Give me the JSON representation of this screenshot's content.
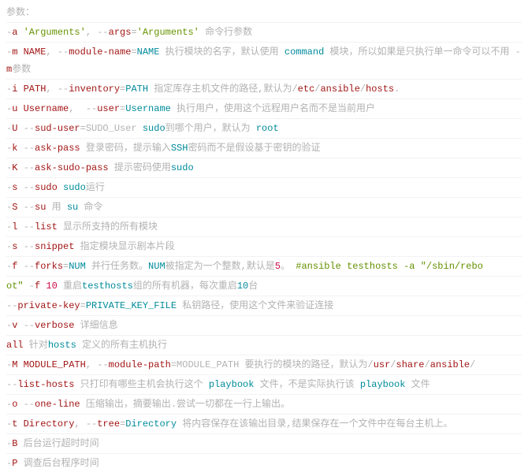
{
  "lines": [
    {
      "segs": [
        {
          "c": "grey",
          "t": "参数："
        }
      ]
    },
    {
      "segs": [
        {
          "c": "grey",
          "t": "-"
        },
        {
          "c": "sel",
          "t": "a "
        },
        {
          "c": "prop",
          "t": "'Arguments'"
        },
        {
          "c": "grey",
          "t": ", --"
        },
        {
          "c": "sel",
          "t": "args"
        },
        {
          "c": "grey",
          "t": "="
        },
        {
          "c": "prop",
          "t": "'Arguments'"
        },
        {
          "c": "grey",
          "t": " 命令行参数"
        }
      ]
    },
    {
      "segs": [
        {
          "c": "grey",
          "t": "-"
        },
        {
          "c": "sel",
          "t": "m NAME"
        },
        {
          "c": "grey",
          "t": ", --"
        },
        {
          "c": "sel",
          "t": "module-name"
        },
        {
          "c": "grey",
          "t": "="
        },
        {
          "c": "val",
          "t": "NAME"
        },
        {
          "c": "grey",
          "t": " 执行模块的名字，默认使用 "
        },
        {
          "c": "val",
          "t": "command"
        },
        {
          "c": "grey",
          "t": " 模块，所以如果是只执行单一命令可以不用 -"
        },
        {
          "c": "sel",
          "t": "m"
        },
        {
          "c": "grey",
          "t": "参数"
        }
      ]
    },
    {
      "segs": [
        {
          "c": "grey",
          "t": "-"
        },
        {
          "c": "sel",
          "t": "i PATH"
        },
        {
          "c": "grey",
          "t": ", --"
        },
        {
          "c": "sel",
          "t": "inventory"
        },
        {
          "c": "grey",
          "t": "="
        },
        {
          "c": "val",
          "t": "PATH"
        },
        {
          "c": "grey",
          "t": " 指定库存主机文件的路径,默认为/"
        },
        {
          "c": "sel",
          "t": "etc"
        },
        {
          "c": "grey",
          "t": "/"
        },
        {
          "c": "sel",
          "t": "ansible"
        },
        {
          "c": "grey",
          "t": "/"
        },
        {
          "c": "sel",
          "t": "hosts"
        },
        {
          "c": "grey",
          "t": "."
        }
      ]
    },
    {
      "segs": [
        {
          "c": "grey",
          "t": "-"
        },
        {
          "c": "sel",
          "t": "u Username"
        },
        {
          "c": "grey",
          "t": ",  --"
        },
        {
          "c": "sel",
          "t": "user"
        },
        {
          "c": "grey",
          "t": "="
        },
        {
          "c": "val",
          "t": "Username"
        },
        {
          "c": "grey",
          "t": " 执行用户，使用这个远程用户名而不是当前用户"
        }
      ]
    },
    {
      "segs": [
        {
          "c": "grey",
          "t": "-"
        },
        {
          "c": "sel",
          "t": "U"
        },
        {
          "c": "grey",
          "t": " --"
        },
        {
          "c": "sel",
          "t": "sud-user"
        },
        {
          "c": "grey",
          "t": "=SUDO_User "
        },
        {
          "c": "val",
          "t": "sudo"
        },
        {
          "c": "grey",
          "t": "到哪个用户，默认为 "
        },
        {
          "c": "val",
          "t": "root"
        }
      ]
    },
    {
      "segs": [
        {
          "c": "grey",
          "t": "-"
        },
        {
          "c": "sel",
          "t": "k"
        },
        {
          "c": "grey",
          "t": " --"
        },
        {
          "c": "sel",
          "t": "ask-pass"
        },
        {
          "c": "grey",
          "t": " 登录密码，提示输入"
        },
        {
          "c": "val",
          "t": "SSH"
        },
        {
          "c": "grey",
          "t": "密码而不是假设基于密钥的验证"
        }
      ]
    },
    {
      "segs": [
        {
          "c": "grey",
          "t": "-"
        },
        {
          "c": "sel",
          "t": "K"
        },
        {
          "c": "grey",
          "t": " --"
        },
        {
          "c": "sel",
          "t": "ask-sudo-pass"
        },
        {
          "c": "grey",
          "t": " 提示密码使用"
        },
        {
          "c": "val",
          "t": "sudo"
        }
      ]
    },
    {
      "segs": [
        {
          "c": "grey",
          "t": "-"
        },
        {
          "c": "sel",
          "t": "s"
        },
        {
          "c": "grey",
          "t": " --"
        },
        {
          "c": "sel",
          "t": "sudo"
        },
        {
          "c": "grey",
          "t": " "
        },
        {
          "c": "val",
          "t": "sudo"
        },
        {
          "c": "grey",
          "t": "运行"
        }
      ]
    },
    {
      "segs": [
        {
          "c": "grey",
          "t": "-"
        },
        {
          "c": "sel",
          "t": "S"
        },
        {
          "c": "grey",
          "t": " --"
        },
        {
          "c": "sel",
          "t": "su"
        },
        {
          "c": "grey",
          "t": " 用 "
        },
        {
          "c": "val",
          "t": "su"
        },
        {
          "c": "grey",
          "t": " 命令"
        }
      ]
    },
    {
      "segs": [
        {
          "c": "grey",
          "t": "-"
        },
        {
          "c": "sel",
          "t": "l"
        },
        {
          "c": "grey",
          "t": " --"
        },
        {
          "c": "sel",
          "t": "list"
        },
        {
          "c": "grey",
          "t": " 显示所支持的所有模块"
        }
      ]
    },
    {
      "segs": [
        {
          "c": "grey",
          "t": "-"
        },
        {
          "c": "sel",
          "t": "s"
        },
        {
          "c": "grey",
          "t": " --"
        },
        {
          "c": "sel",
          "t": "snippet"
        },
        {
          "c": "grey",
          "t": " 指定模块显示剧本片段"
        }
      ]
    },
    {
      "segs": [
        {
          "c": "grey",
          "t": "-"
        },
        {
          "c": "sel",
          "t": "f"
        },
        {
          "c": "grey",
          "t": " --"
        },
        {
          "c": "sel",
          "t": "forks"
        },
        {
          "c": "grey",
          "t": "="
        },
        {
          "c": "val",
          "t": "NUM"
        },
        {
          "c": "grey",
          "t": " 并行任务数。"
        },
        {
          "c": "val",
          "t": "NUM"
        },
        {
          "c": "grey",
          "t": "被指定为一个整数,默认是"
        },
        {
          "c": "red",
          "t": "5"
        },
        {
          "c": "grey",
          "t": "。 "
        },
        {
          "c": "cmt",
          "t": "#ansible testhosts -a \"/sbin/rebo"
        }
      ]
    },
    {
      "segs": [
        {
          "c": "cmt",
          "t": "ot\""
        },
        {
          "c": "grey",
          "t": " -"
        },
        {
          "c": "sel",
          "t": "f"
        },
        {
          "c": "grey",
          "t": " "
        },
        {
          "c": "red",
          "t": "10"
        },
        {
          "c": "grey",
          "t": " 重启"
        },
        {
          "c": "val",
          "t": "testhosts"
        },
        {
          "c": "grey",
          "t": "组的所有机器，每次重启"
        },
        {
          "c": "val",
          "t": "10"
        },
        {
          "c": "grey",
          "t": "台"
        }
      ]
    },
    {
      "segs": [
        {
          "c": "grey",
          "t": "--"
        },
        {
          "c": "sel",
          "t": "private-key"
        },
        {
          "c": "grey",
          "t": "="
        },
        {
          "c": "val",
          "t": "PRIVATE_KEY_FILE"
        },
        {
          "c": "grey",
          "t": " 私钥路径，使用这个文件来验证连接"
        }
      ]
    },
    {
      "segs": [
        {
          "c": "grey",
          "t": "-"
        },
        {
          "c": "sel",
          "t": "v"
        },
        {
          "c": "grey",
          "t": " --"
        },
        {
          "c": "sel",
          "t": "verbose"
        },
        {
          "c": "grey",
          "t": " 详细信息"
        }
      ]
    },
    {
      "segs": [
        {
          "c": "sel",
          "t": "all"
        },
        {
          "c": "grey",
          "t": " 针对"
        },
        {
          "c": "val",
          "t": "hosts"
        },
        {
          "c": "grey",
          "t": " 定义的所有主机执行"
        }
      ]
    },
    {
      "segs": [
        {
          "c": "grey",
          "t": "-"
        },
        {
          "c": "sel",
          "t": "M MODULE_PATH"
        },
        {
          "c": "grey",
          "t": ", --"
        },
        {
          "c": "sel",
          "t": "module-path"
        },
        {
          "c": "grey",
          "t": "=MODULE_PATH 要执行的模块的路径，默认为/"
        },
        {
          "c": "sel",
          "t": "usr"
        },
        {
          "c": "grey",
          "t": "/"
        },
        {
          "c": "sel",
          "t": "share"
        },
        {
          "c": "grey",
          "t": "/"
        },
        {
          "c": "sel",
          "t": "ansible"
        },
        {
          "c": "grey",
          "t": "/"
        }
      ]
    },
    {
      "segs": [
        {
          "c": "grey",
          "t": "--"
        },
        {
          "c": "sel",
          "t": "list-hosts"
        },
        {
          "c": "grey",
          "t": " 只打印有哪些主机会执行这个 "
        },
        {
          "c": "val",
          "t": "playbook"
        },
        {
          "c": "grey",
          "t": " 文件，不是实际执行该 "
        },
        {
          "c": "val",
          "t": "playbook"
        },
        {
          "c": "grey",
          "t": " 文件"
        }
      ]
    },
    {
      "segs": [
        {
          "c": "grey",
          "t": "-"
        },
        {
          "c": "sel",
          "t": "o"
        },
        {
          "c": "grey",
          "t": " --"
        },
        {
          "c": "sel",
          "t": "one-line"
        },
        {
          "c": "grey",
          "t": " 压缩输出，摘要输出.尝试一切都在一行上输出。"
        }
      ]
    },
    {
      "segs": [
        {
          "c": "grey",
          "t": "-"
        },
        {
          "c": "sel",
          "t": "t Directory"
        },
        {
          "c": "grey",
          "t": ", --"
        },
        {
          "c": "sel",
          "t": "tree"
        },
        {
          "c": "grey",
          "t": "="
        },
        {
          "c": "val",
          "t": "Directory"
        },
        {
          "c": "grey",
          "t": " 将内容保存在该输出目录,结果保存在一个文件中在每台主机上。"
        }
      ]
    },
    {
      "segs": [
        {
          "c": "grey",
          "t": "-"
        },
        {
          "c": "sel",
          "t": "B"
        },
        {
          "c": "grey",
          "t": " 后台运行超时时间"
        }
      ]
    },
    {
      "segs": [
        {
          "c": "grey",
          "t": "-"
        },
        {
          "c": "sel",
          "t": "P"
        },
        {
          "c": "grey",
          "t": " 调查后台程序时间"
        }
      ]
    }
  ]
}
